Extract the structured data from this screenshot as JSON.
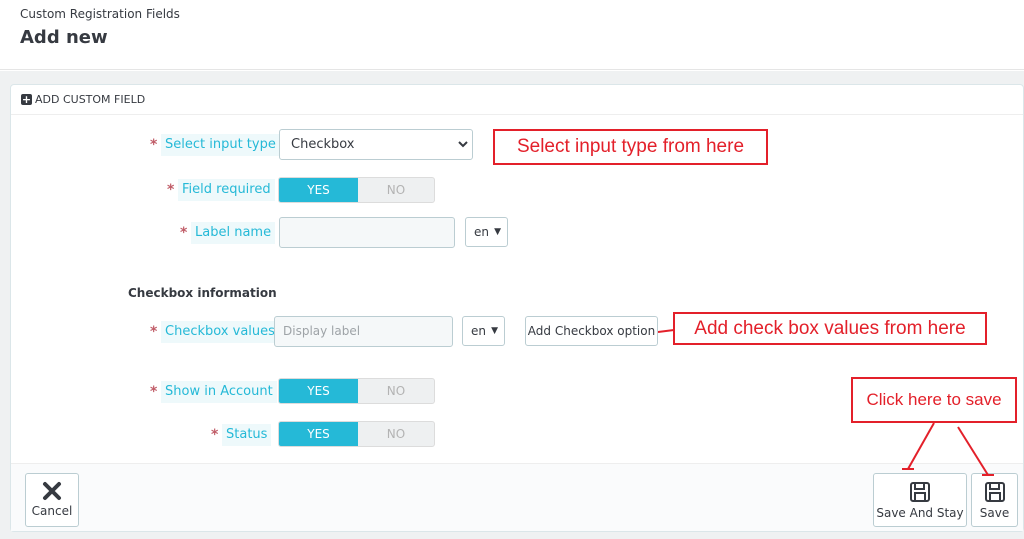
{
  "header": {
    "breadcrumb": "Custom Registration Fields",
    "title": "Add new"
  },
  "panel": {
    "heading_icon": "plus-square-icon",
    "heading": "ADD CUSTOM FIELD"
  },
  "form": {
    "required_mark": "*",
    "input_type_label": "Select input type",
    "input_type_value": "Checkbox",
    "field_required_label": "Field required",
    "label_name_label": "Label name",
    "label_name_value": "",
    "lang": "en",
    "section_title": "Checkbox information",
    "checkbox_values_label": "Checkbox values",
    "checkbox_values_placeholder": "Display label",
    "add_option_button": "Add Checkbox option",
    "show_in_account_label": "Show in Account",
    "status_label": "Status",
    "yes": "YES",
    "no": "NO"
  },
  "annotations": {
    "select_type": "Select input type from here",
    "checkbox_values": "Add check box values from here",
    "save_hint": "Click here to save",
    "color": "#e3202a"
  },
  "footer": {
    "cancel": "Cancel",
    "cancel_icon": "close-icon",
    "save_and_stay": "Save And Stay",
    "save": "Save",
    "save_icon": "floppy-disk-icon"
  },
  "colors": {
    "accent": "#25b9d7",
    "required": "#c05c67"
  }
}
